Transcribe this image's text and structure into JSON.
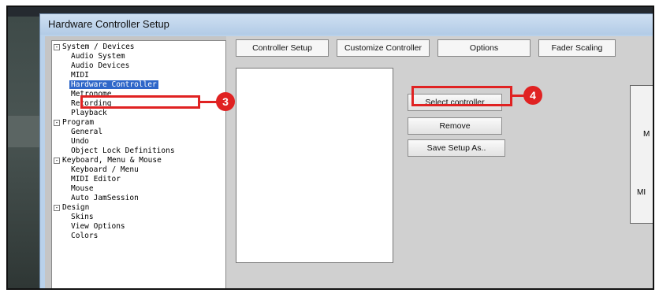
{
  "window": {
    "title": "Hardware Controller Setup"
  },
  "tree": {
    "items": [
      {
        "label": "System / Devices",
        "expander": "-"
      },
      {
        "label": "Audio System"
      },
      {
        "label": "Audio Devices"
      },
      {
        "label": "MIDI"
      },
      {
        "label": "Hardware Controller",
        "selected": true
      },
      {
        "label": "Metronome"
      },
      {
        "label": "Recording"
      },
      {
        "label": "Playback"
      },
      {
        "label": "Program",
        "expander": "-"
      },
      {
        "label": "General"
      },
      {
        "label": "Undo"
      },
      {
        "label": "Object Lock Definitions"
      },
      {
        "label": "Keyboard, Menu & Mouse",
        "expander": "-"
      },
      {
        "label": "Keyboard / Menu"
      },
      {
        "label": "MIDI Editor"
      },
      {
        "label": "Mouse"
      },
      {
        "label": "Auto JamSession"
      },
      {
        "label": "Design",
        "expander": "-"
      },
      {
        "label": "Skins"
      },
      {
        "label": "View Options"
      },
      {
        "label": "Colors"
      }
    ]
  },
  "tabs": [
    "Controller Setup",
    "Customize Controller",
    "Options",
    "Fader Scaling"
  ],
  "buttons": {
    "select_controller": "Select controller",
    "remove": "Remove",
    "save_setup_as": "Save Setup As.."
  },
  "callouts": {
    "tree_marker": "3",
    "button_marker": "4"
  },
  "side_panel": {
    "label_1": "M",
    "label_2": "MI"
  },
  "colors": {
    "annotation_red": "#e02222",
    "selection_blue": "#2f67c9",
    "titlebar": "#b9d1ea"
  }
}
